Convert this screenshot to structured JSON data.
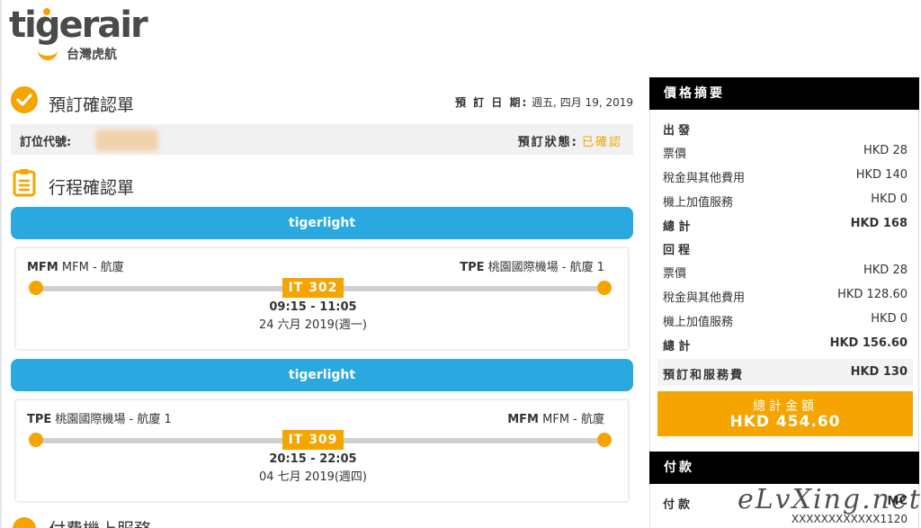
{
  "logo": {
    "wordmark": "tigerair",
    "subtitle": "台灣虎航"
  },
  "confirmation": {
    "title": "預訂確認單",
    "date_label": "預 訂 日 期:",
    "date_value": "週五, 四月 19, 2019",
    "code_label": "訂位代號:",
    "status_label": "預訂狀態:",
    "status_value": "已確認"
  },
  "itinerary": {
    "title": "行程確認單",
    "flights": [
      {
        "fare": "tigerlight",
        "from_code": "MFM",
        "from_name": "MFM - 航廈",
        "to_code": "TPE",
        "to_name": "桃園國際機場 - 航廈 1",
        "flight_no": "IT 302",
        "time": "09:15 - 11:05",
        "date": "24 六月 2019(週一)"
      },
      {
        "fare": "tigerlight",
        "from_code": "TPE",
        "from_name": "桃園國際機場 - 航廈 1",
        "to_code": "MFM",
        "to_name": "MFM - 航廈",
        "flight_no": "IT 309",
        "time": "20:15 - 22:05",
        "date": "04 七月 2019(週四)"
      }
    ]
  },
  "next_section_title": "付費機上服務",
  "price_summary": {
    "title": "價格摘要",
    "outbound_label": "出發",
    "outbound": [
      {
        "label": "票價",
        "value": "HKD 28"
      },
      {
        "label": "稅金與其他費用",
        "value": "HKD 140"
      },
      {
        "label": "機上加值服務",
        "value": "HKD 0"
      }
    ],
    "outbound_total": {
      "label": "總 計",
      "value": "HKD 168"
    },
    "return_label": "回程",
    "return": [
      {
        "label": "票價",
        "value": "HKD 28"
      },
      {
        "label": "稅金與其他費用",
        "value": "HKD 128.60"
      },
      {
        "label": "機上加值服務",
        "value": "HKD 0"
      }
    ],
    "return_total": {
      "label": "總 計",
      "value": "HKD 156.60"
    },
    "booking_fee": {
      "label": "預訂和服務費",
      "value": "HKD 130"
    },
    "grand_total": {
      "label": "總計金額",
      "value": "HKD 454.60"
    }
  },
  "payment": {
    "title": "付款",
    "label": "付款",
    "method": "MC",
    "card": "XXXXXXXXXXXX1120"
  },
  "watermark": "eLvXing.net",
  "colors": {
    "accent": "#f5a400",
    "fare_bar": "#29a9e0",
    "panel_head": "#000000"
  }
}
